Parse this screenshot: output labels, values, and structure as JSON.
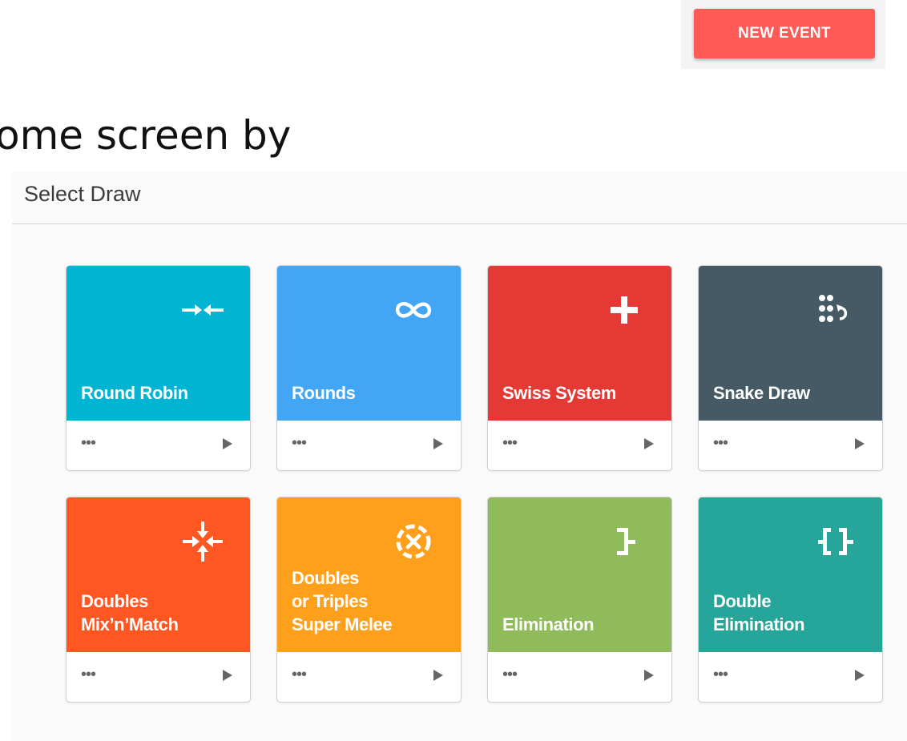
{
  "header": {
    "new_event_label": "NEW EVENT",
    "background_heading": "ome screen by"
  },
  "dialog": {
    "title": "Select Draw",
    "cards": [
      {
        "title": [
          "Round Robin"
        ],
        "color": "#00b4d2",
        "icon": "arrows-converge-icon"
      },
      {
        "title": [
          "Rounds"
        ],
        "color": "#42a5f5",
        "icon": "infinity-icon"
      },
      {
        "title": [
          "Swiss System"
        ],
        "color": "#e53935",
        "icon": "plus-icon"
      },
      {
        "title": [
          "Snake Draw"
        ],
        "color": "#455a64",
        "icon": "dots-rotate-icon"
      },
      {
        "title": [
          "Doubles",
          "Mix’n’Match"
        ],
        "color": "#ff5722",
        "icon": "cross-arrows-icon"
      },
      {
        "title": [
          "Doubles",
          "or Triples",
          "Super Melee"
        ],
        "color": "#ffa01c",
        "icon": "circle-x-icon"
      },
      {
        "title": [
          "Elimination"
        ],
        "color": "#8fbb5b",
        "icon": "bracket-icon"
      },
      {
        "title": [
          "Double",
          "Elimination"
        ],
        "color": "#26a69a",
        "icon": "double-bracket-icon"
      }
    ],
    "more_symbol": "•••"
  }
}
